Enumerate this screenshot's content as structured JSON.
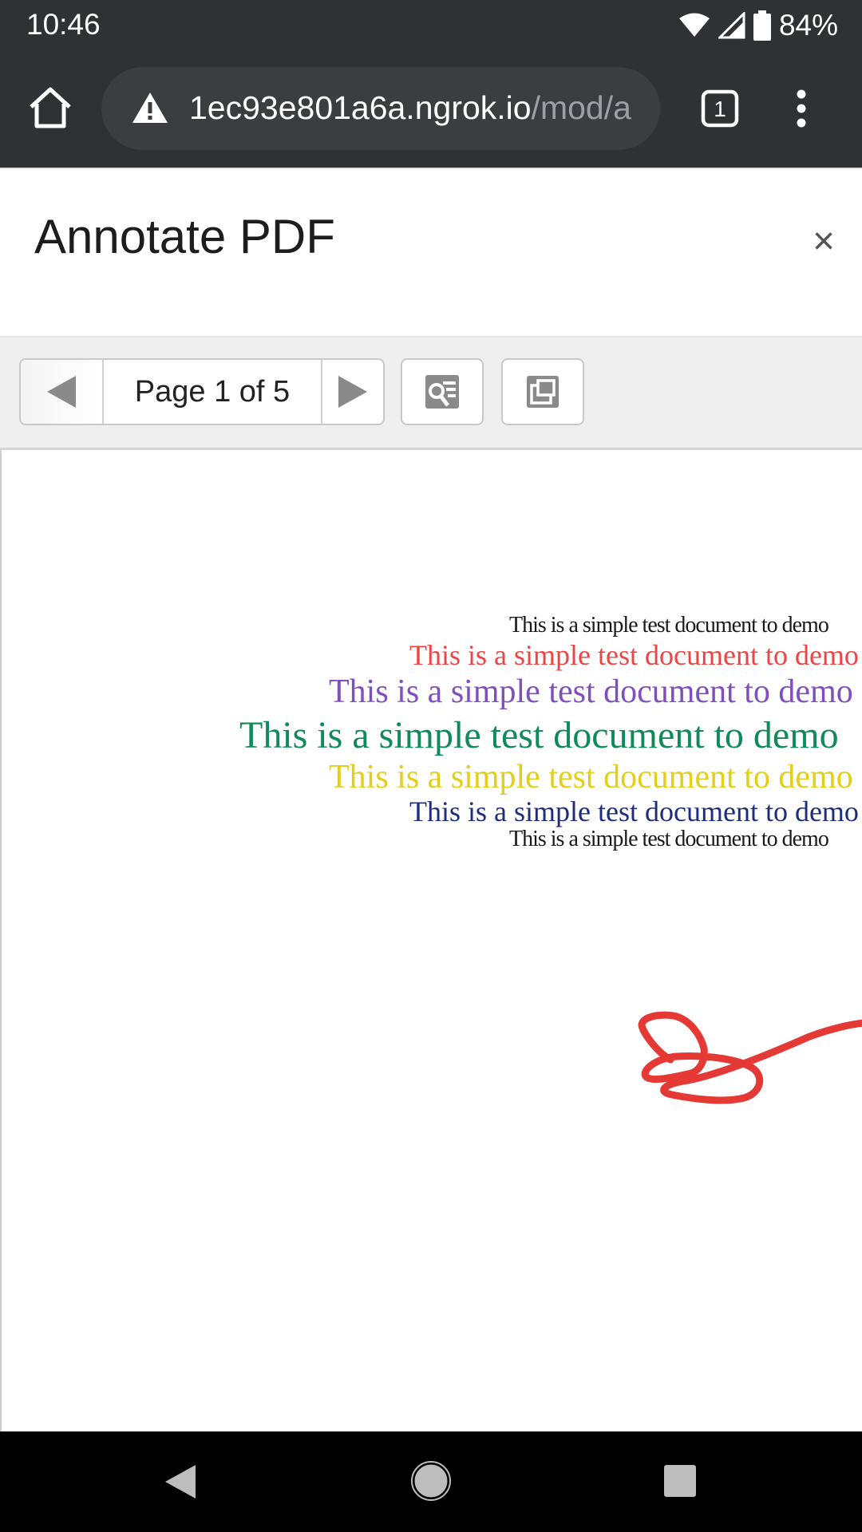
{
  "status_bar": {
    "time": "10:46",
    "battery_percent": "84%",
    "icons": [
      "wifi-icon",
      "signal-icon",
      "battery-icon"
    ]
  },
  "browser": {
    "url_host": "1ec93e801a6a.ngrok.io",
    "url_path": "/mod/a",
    "tab_count": "1",
    "icons": [
      "home-icon",
      "warning-icon",
      "tabs-icon",
      "more-vert-icon"
    ]
  },
  "dialog": {
    "title": "Annotate PDF",
    "close_label": "×"
  },
  "toolbar": {
    "page_label": "Page 1 of 5",
    "icons": [
      "prev-page-icon",
      "next-page-icon",
      "search-text-icon",
      "expand-icon"
    ]
  },
  "document": {
    "lines": [
      "This is a simple test document to demo",
      "This is a simple test document to demo",
      "This is a simple test document to demo",
      "This is a simple test document to demo",
      "This is a simple test document to demo",
      "This is a simple test document to demo",
      "This is a simple test document to demo"
    ],
    "line_colors": [
      "#1a1a1a",
      "#ef4444",
      "#7e4fbf",
      "#118a5a",
      "#e2cf1a",
      "#1e2d7e",
      "#1a1a1a"
    ],
    "annotation_color": "#e53935"
  },
  "android_nav": {
    "icons": [
      "back-icon",
      "home-circle-icon",
      "recents-icon"
    ]
  }
}
